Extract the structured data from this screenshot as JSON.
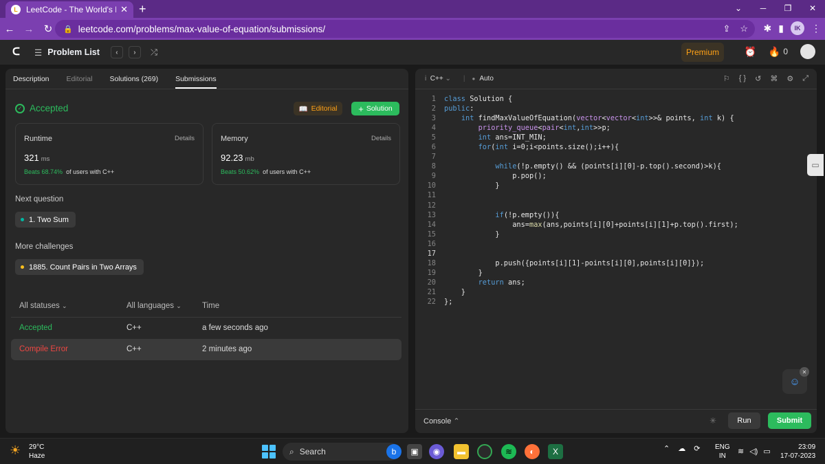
{
  "browser": {
    "tab_title": "LeetCode - The World's Leading",
    "url": "leetcode.com/problems/max-value-of-equation/submissions/",
    "profile_initials": "IK"
  },
  "header": {
    "problem_list": "Problem List",
    "premium": "Premium",
    "streak_count": "0"
  },
  "left": {
    "tabs": [
      {
        "label": "Description"
      },
      {
        "label": "Editorial"
      },
      {
        "label": "Solutions (269)"
      },
      {
        "label": "Submissions"
      }
    ],
    "status": "Accepted",
    "editorial_button": "Editorial",
    "solution_button": "Solution",
    "runtime": {
      "label": "Runtime",
      "details": "Details",
      "value": "321",
      "unit": "ms",
      "beats": "Beats 68.74%",
      "beats_suffix": "of users with C++"
    },
    "memory": {
      "label": "Memory",
      "details": "Details",
      "value": "92.23",
      "unit": "mb",
      "beats": "Beats 50.62%",
      "beats_suffix": "of users with C++"
    },
    "next_question_label": "Next question",
    "next_question": "1. Two Sum",
    "more_challenges_label": "More challenges",
    "more_challenge": "1885. Count Pairs in Two Arrays",
    "table_headers": {
      "status": "All statuses",
      "language": "All languages",
      "time": "Time"
    },
    "submissions": [
      {
        "status": "Accepted",
        "status_color": "#2cbb5d",
        "language": "C++",
        "time": "a few seconds ago"
      },
      {
        "status": "Compile Error",
        "status_color": "#ef4743",
        "language": "C++",
        "time": "2 minutes ago"
      }
    ]
  },
  "editor": {
    "language": "C++",
    "mode": "Auto",
    "lines": [
      "class Solution {",
      "public:",
      "    int findMaxValueOfEquation(vector<vector<int>>& points, int k) {",
      "        priority_queue<pair<int,int>>p;",
      "        int ans=INT_MIN;",
      "        for(int i=0;i<points.size();i++){",
      "",
      "            while(!p.empty() && (points[i][0]-p.top().second)>k){",
      "                p.pop();",
      "            }",
      "",
      "",
      "            if(!p.empty()){",
      "                ans=max(ans,points[i][0]+points[i][1]+p.top().first);",
      "            }",
      "",
      "",
      "            p.push({points[i][1]-points[i][0],points[i][0]});",
      "        }",
      "        return ans;",
      "    }",
      "};"
    ],
    "console_label": "Console",
    "run_button": "Run",
    "submit_button": "Submit"
  },
  "taskbar": {
    "temperature": "29°C",
    "weather": "Haze",
    "search": "Search",
    "lang_top": "ENG",
    "lang_bottom": "IN",
    "time": "23:09",
    "date": "17-07-2023"
  }
}
